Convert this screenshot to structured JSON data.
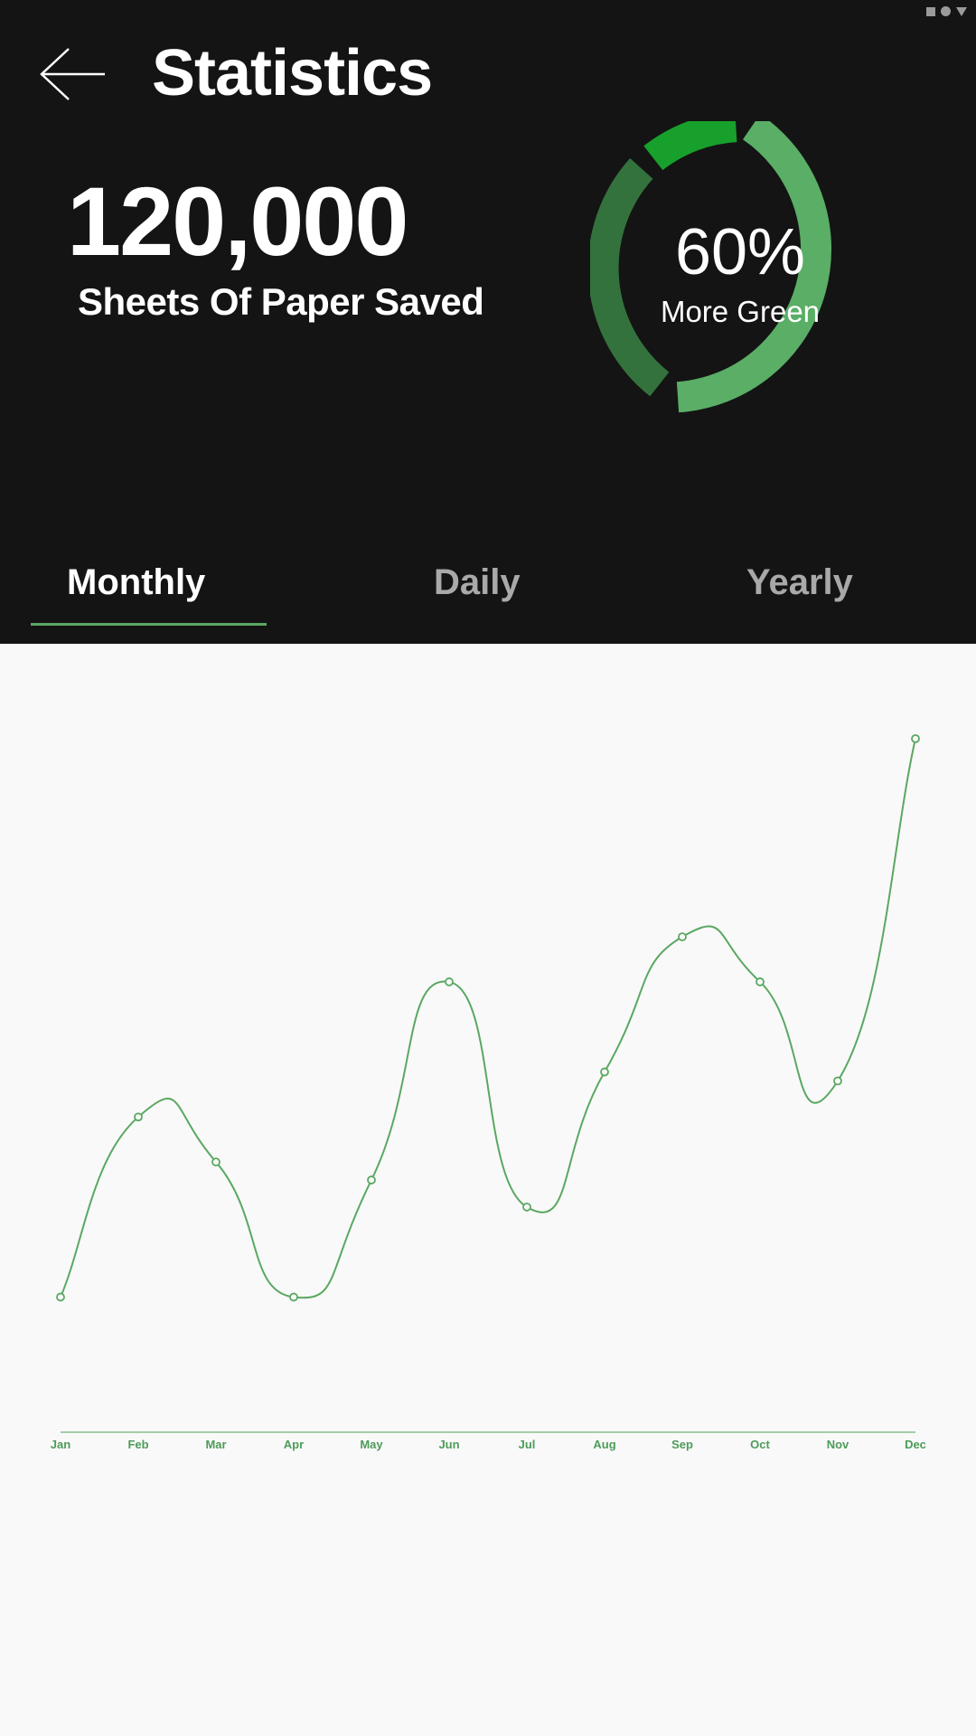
{
  "header": {
    "title": "Statistics",
    "stat_value": "120,000",
    "stat_label": "Sheets Of Paper Saved",
    "donut_percent": "60%",
    "donut_label": "More Green",
    "donut_colors": [
      "#5aae66",
      "#18a02c",
      "#34723d"
    ]
  },
  "icons": {
    "back": "arrow-left-icon",
    "status": [
      "square-icon",
      "circle-icon",
      "triangle-down-icon"
    ]
  },
  "tabs": [
    {
      "label": "Monthly",
      "active": true
    },
    {
      "label": "Daily",
      "active": false
    },
    {
      "label": "Yearly",
      "active": false
    }
  ],
  "colors": {
    "background_dark": "#141414",
    "accent_green": "#5aa862",
    "tab_inactive": "#a9a9a9",
    "chart_bg": "#f9f9f9"
  },
  "chart_data": {
    "type": "line",
    "categories": [
      "Jan",
      "Feb",
      "Mar",
      "Apr",
      "May",
      "Jun",
      "Jul",
      "Aug",
      "Sep",
      "Oct",
      "Nov",
      "Dec"
    ],
    "series": [
      {
        "values": [
          15,
          55,
          45,
          15,
          41,
          85,
          35,
          65,
          95,
          85,
          63,
          139
        ]
      }
    ],
    "ylim": [
      -15,
      140
    ],
    "smooth": true,
    "grid": false
  }
}
